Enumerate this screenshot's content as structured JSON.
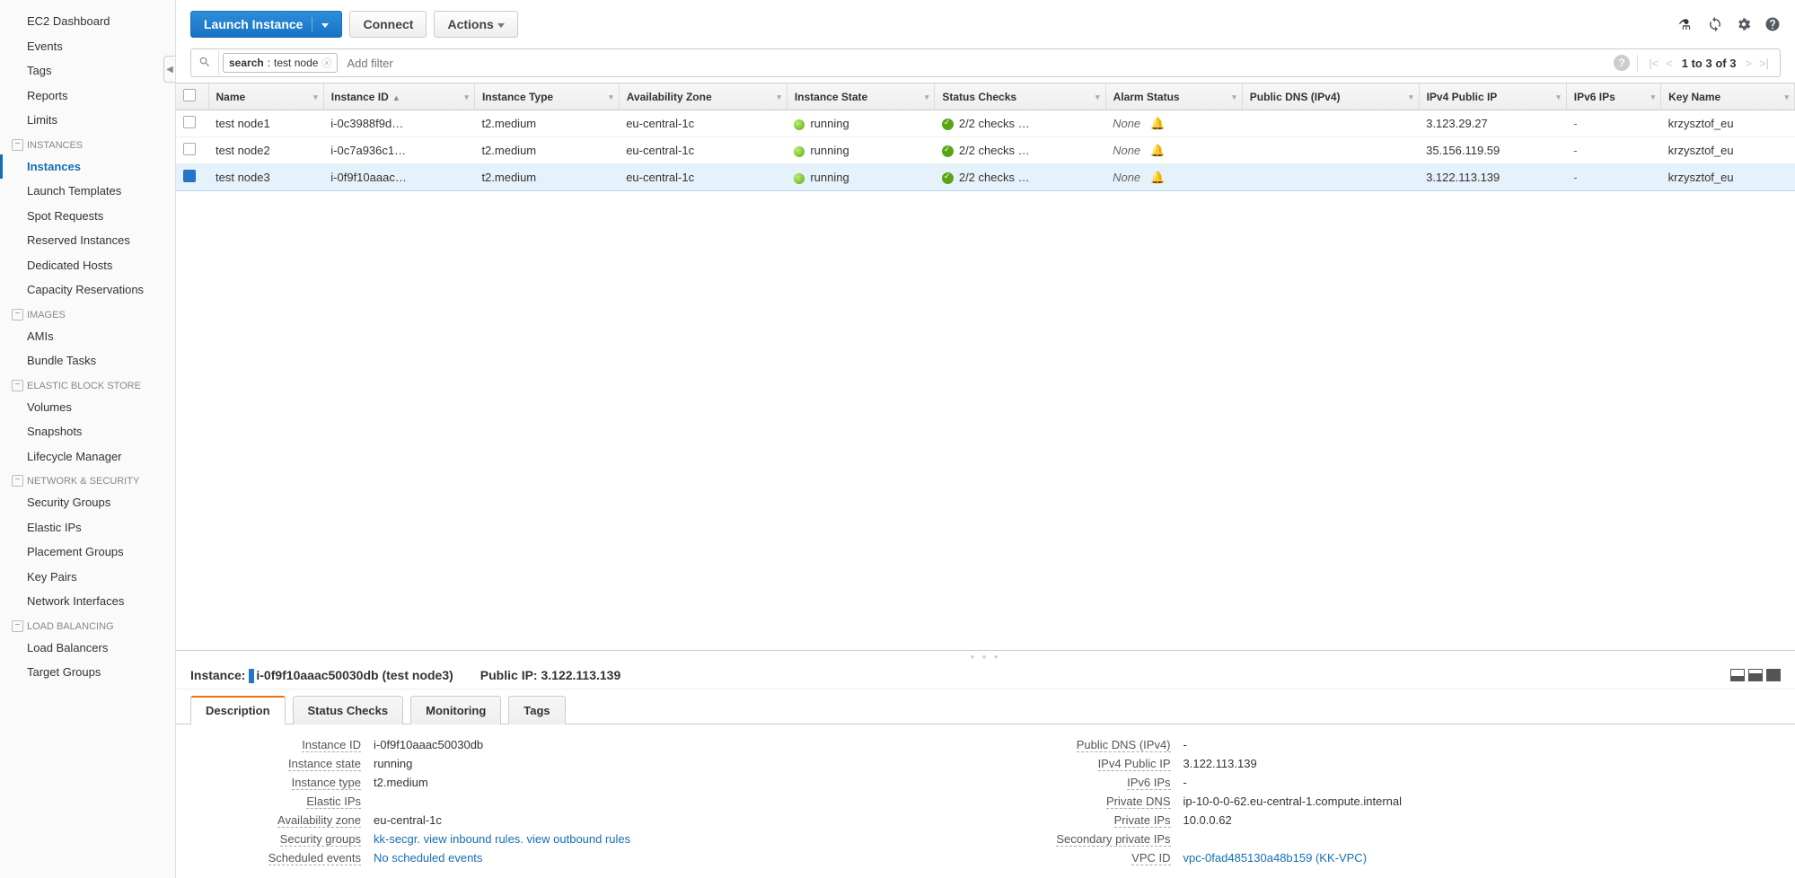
{
  "sidebar": {
    "top": [
      "EC2 Dashboard",
      "Events",
      "Tags",
      "Reports",
      "Limits"
    ],
    "groups": [
      {
        "title": "Instances",
        "items": [
          "Instances",
          "Launch Templates",
          "Spot Requests",
          "Reserved Instances",
          "Dedicated Hosts",
          "Capacity Reservations"
        ],
        "activeIndex": 0
      },
      {
        "title": "Images",
        "items": [
          "AMIs",
          "Bundle Tasks"
        ]
      },
      {
        "title": "Elastic Block Store",
        "items": [
          "Volumes",
          "Snapshots",
          "Lifecycle Manager"
        ]
      },
      {
        "title": "Network & Security",
        "items": [
          "Security Groups",
          "Elastic IPs",
          "Placement Groups",
          "Key Pairs",
          "Network Interfaces"
        ]
      },
      {
        "title": "Load Balancing",
        "items": [
          "Load Balancers",
          "Target Groups"
        ]
      }
    ]
  },
  "toolbar": {
    "launch": "Launch Instance",
    "connect": "Connect",
    "actions": "Actions"
  },
  "filter": {
    "key": "search",
    "value": "test node",
    "placeholder": "Add filter",
    "pager": "1 to 3 of 3"
  },
  "columns": [
    "Name",
    "Instance ID",
    "Instance Type",
    "Availability Zone",
    "Instance State",
    "Status Checks",
    "Alarm Status",
    "Public DNS (IPv4)",
    "IPv4 Public IP",
    "IPv6 IPs",
    "Key Name"
  ],
  "sortColumnIndex": 1,
  "rows": [
    {
      "selected": false,
      "name": "test node1",
      "instanceId": "i-0c3988f9d…",
      "type": "t2.medium",
      "az": "eu-central-1c",
      "state": "running",
      "checks": "2/2 checks …",
      "alarm": "None",
      "publicDns": "",
      "ipv4": "3.123.29.27",
      "ipv6": "-",
      "keyName": "krzysztof_eu"
    },
    {
      "selected": false,
      "name": "test node2",
      "instanceId": "i-0c7a936c1…",
      "type": "t2.medium",
      "az": "eu-central-1c",
      "state": "running",
      "checks": "2/2 checks …",
      "alarm": "None",
      "publicDns": "",
      "ipv4": "35.156.119.59",
      "ipv6": "-",
      "keyName": "krzysztof_eu"
    },
    {
      "selected": true,
      "name": "test node3",
      "instanceId": "i-0f9f10aaac…",
      "type": "t2.medium",
      "az": "eu-central-1c",
      "state": "running",
      "checks": "2/2 checks …",
      "alarm": "None",
      "publicDns": "",
      "ipv4": "3.122.113.139",
      "ipv6": "-",
      "keyName": "krzysztof_eu"
    }
  ],
  "detail": {
    "headerLabel": "Instance:",
    "headerId": "i-0f9f10aaac50030db (test node3)",
    "publicIpLabel": "Public IP:",
    "publicIp": "3.122.113.139",
    "tabs": [
      "Description",
      "Status Checks",
      "Monitoring",
      "Tags"
    ],
    "activeTab": 0,
    "left": [
      {
        "k": "Instance ID",
        "v": "i-0f9f10aaac50030db"
      },
      {
        "k": "Instance state",
        "v": "running"
      },
      {
        "k": "Instance type",
        "v": "t2.medium"
      },
      {
        "k": "Elastic IPs",
        "v": ""
      },
      {
        "k": "Availability zone",
        "v": "eu-central-1c"
      },
      {
        "k": "Security groups",
        "v": "kk-secgr. view inbound rules. view outbound rules",
        "link": true
      },
      {
        "k": "Scheduled events",
        "v": "No scheduled events",
        "link": true
      }
    ],
    "right": [
      {
        "k": "Public DNS (IPv4)",
        "v": "-"
      },
      {
        "k": "IPv4 Public IP",
        "v": "3.122.113.139"
      },
      {
        "k": "IPv6 IPs",
        "v": "-"
      },
      {
        "k": "Private DNS",
        "v": "ip-10-0-0-62.eu-central-1.compute.internal"
      },
      {
        "k": "Private IPs",
        "v": "10.0.0.62"
      },
      {
        "k": "Secondary private IPs",
        "v": ""
      },
      {
        "k": "VPC ID",
        "v": "vpc-0fad485130a48b159 (KK-VPC)",
        "link": true
      }
    ]
  }
}
